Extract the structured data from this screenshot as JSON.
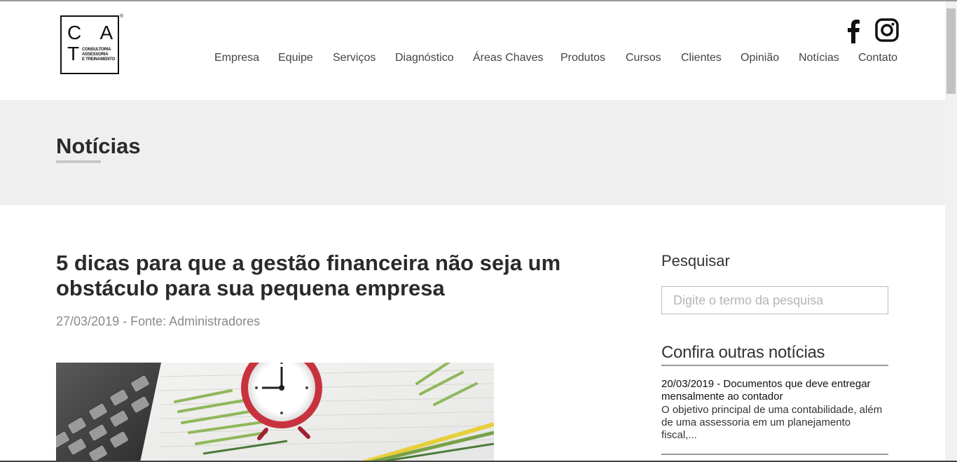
{
  "logo": {
    "letters": "C A T",
    "registered": "®",
    "subtitle": [
      "CONSULTORIA",
      "ASSESSORIA",
      "E TREINAMENTO"
    ]
  },
  "social": {
    "facebook_icon": "facebook-icon",
    "instagram_icon": "instagram-icon"
  },
  "nav": {
    "items": [
      {
        "label": "Empresa"
      },
      {
        "label": "Equipe"
      },
      {
        "label": "Serviços"
      },
      {
        "label": "Diagnóstico"
      },
      {
        "label": "Áreas Chaves"
      },
      {
        "label": "Produtos"
      },
      {
        "label": "Cursos"
      },
      {
        "label": "Clientes"
      },
      {
        "label": "Opinião"
      },
      {
        "label": "Notícias"
      },
      {
        "label": "Contato"
      }
    ]
  },
  "band": {
    "title": "Notícias"
  },
  "article": {
    "title": "5 dicas para que a gestão financeira não seja um obstáculo para sua pequena empresa",
    "meta": "27/03/2019 - Fonte: Administradores"
  },
  "sidebar": {
    "search_heading": "Pesquisar",
    "search_placeholder": "Digite o termo da pesquisa",
    "other_heading": "Confira outras notícias",
    "news": [
      {
        "date_title": "20/03/2019 - Documentos que deve entregar mensalmente ao contador",
        "excerpt": "O objetivo principal de uma contabilidade, além de uma assessoria em um planejamento fiscal,..."
      }
    ]
  },
  "colors": {
    "band_bg": "#efefef",
    "text_dark": "#2a2a2a",
    "meta_gray": "#8a8a8a"
  }
}
